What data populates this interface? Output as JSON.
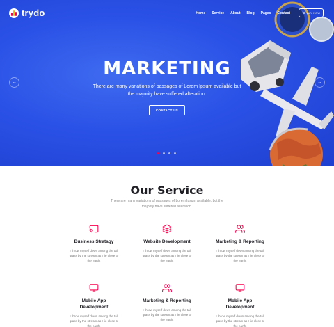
{
  "brand": {
    "name": "trydo"
  },
  "nav": {
    "items": [
      "Home",
      "Service",
      "About",
      "Blog",
      "Pages",
      "Contact"
    ],
    "cta": "BUY NOW"
  },
  "hero": {
    "title": "MARKETING",
    "subtitle": "There are many variations of passages of Lorem Ipsum available but the majority have suffered alteration.",
    "button": "CONTACT US",
    "slides": 4,
    "active_slide": 1
  },
  "service": {
    "title": "Our Service",
    "subtitle": "There are many variations of passages of Lorem Ipsum available, but the majority have suffered alteration.",
    "cards": [
      {
        "icon": "cast-icon",
        "title": "Business Stratagy",
        "text": "I throw myself down among the tall grass by the stream as I lie close to the earth."
      },
      {
        "icon": "layers-icon",
        "title": "Website Development",
        "text": "I throw myself down among the tall grass by the stream as I lie close to the earth."
      },
      {
        "icon": "users-icon",
        "title": "Marketing & Reporting",
        "text": "I throw myself down among the tall grass by the stream as I lie close to the earth."
      },
      {
        "icon": "monitor-icon",
        "title": "Mobile App Development",
        "text": "I throw myself down among the tall grass by the stream as I lie close to the earth."
      },
      {
        "icon": "users-icon",
        "title": "Marketing & Reporting",
        "text": "I throw myself down among the tall grass by the stream as I lie close to the earth."
      },
      {
        "icon": "monitor-icon",
        "title": "Mobile App Development",
        "text": "I throw myself down among the tall grass by the stream as I lie close to the earth."
      }
    ]
  },
  "colors": {
    "accent": "#f9004d",
    "hero_blue": "#2a51e6",
    "heading": "#1f1f25"
  }
}
